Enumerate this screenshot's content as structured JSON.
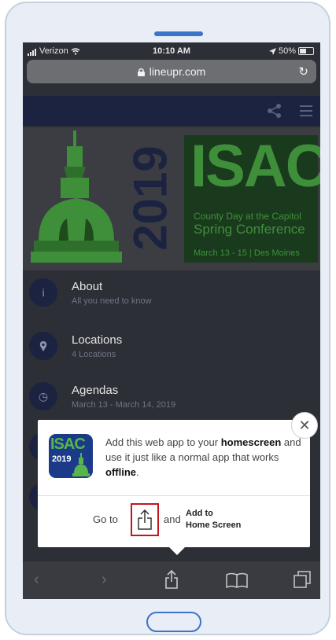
{
  "status_bar": {
    "carrier": "Verizon",
    "time": "10:10 AM",
    "battery": "50%"
  },
  "browser": {
    "url": "lineupr.com"
  },
  "hero": {
    "isac": "ISAC",
    "year": "2019",
    "line1": "County Day at the Capitol",
    "line2": "Spring Conference",
    "line3": "March 13 - 15 | Des Moines"
  },
  "list": [
    {
      "title": "About",
      "subtitle": "All you need to know",
      "icon": "info-icon",
      "glyph": "i"
    },
    {
      "title": "Locations",
      "subtitle": "4 Locations",
      "icon": "location-pin-icon",
      "glyph": "⬤"
    },
    {
      "title": "Agendas",
      "subtitle": "March 13 - March 14, 2019",
      "icon": "clock-icon",
      "glyph": "◷"
    }
  ],
  "popup": {
    "icon_text_top": "ISAC",
    "icon_text_year": "2019",
    "message_pre": "Add this web app to your ",
    "message_bold1": "homescreen",
    "message_mid": " and use it just like a normal app that works ",
    "message_bold2": "offline",
    "message_post": ".",
    "goto": "Go to",
    "and": "and",
    "add_line1": "Add to",
    "add_line2": "Home Screen",
    "close_glyph": "✕"
  },
  "toolbar": {
    "back": "‹",
    "forward": "›"
  },
  "colors": {
    "navy": "#1b2341",
    "green": "#3f8f3a",
    "highlight": "#c0171c"
  }
}
